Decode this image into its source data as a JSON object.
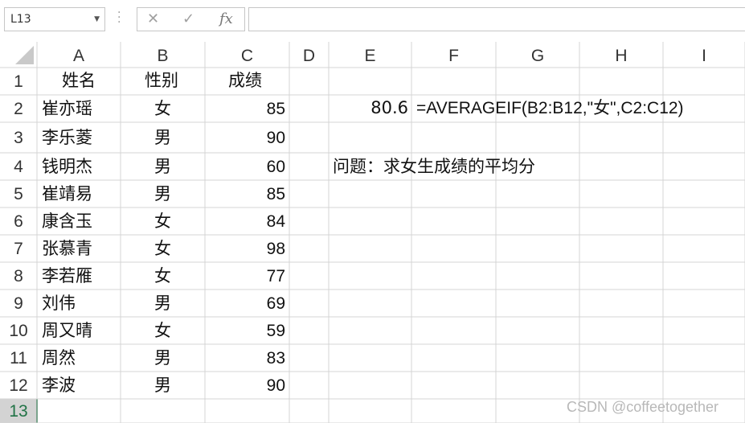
{
  "formula_bar": {
    "name_box": "L13",
    "cancel_icon": "✕",
    "confirm_icon": "✓",
    "fx_label": "fx",
    "formula": ""
  },
  "columns": [
    "A",
    "B",
    "C",
    "D",
    "E",
    "F",
    "G",
    "H",
    "I"
  ],
  "rows": [
    "1",
    "2",
    "3",
    "4",
    "5",
    "6",
    "7",
    "8",
    "9",
    "10",
    "11",
    "12",
    "13"
  ],
  "selected_row": "13",
  "sheet": {
    "header": {
      "name": "姓名",
      "gender": "性别",
      "score": "成绩"
    },
    "records": [
      {
        "name": "崔亦瑶",
        "gender": "女",
        "score": "85"
      },
      {
        "name": "李乐菱",
        "gender": "男",
        "score": "90"
      },
      {
        "name": "钱明杰",
        "gender": "男",
        "score": "60"
      },
      {
        "name": "崔靖易",
        "gender": "男",
        "score": "85"
      },
      {
        "name": "康含玉",
        "gender": "女",
        "score": "84"
      },
      {
        "name": "张慕青",
        "gender": "女",
        "score": "98"
      },
      {
        "name": "李若雁",
        "gender": "女",
        "score": "77"
      },
      {
        "name": "刘伟",
        "gender": "男",
        "score": "69"
      },
      {
        "name": "周又晴",
        "gender": "女",
        "score": "59"
      },
      {
        "name": "周然",
        "gender": "男",
        "score": "83"
      },
      {
        "name": "李波",
        "gender": "男",
        "score": "90"
      }
    ],
    "result_value": "80.6",
    "formula_text": "=AVERAGEIF(B2:B12,\"女\",C2:C12)",
    "question": "问题：求女生成绩的平均分"
  },
  "watermark": "CSDN @coffeetogether",
  "colors": {
    "grid_line": "#d4d4d4",
    "header_bg": "#ffffff",
    "selected_header_bg": "#d3d3d3",
    "selected_header_text": "#217346"
  }
}
